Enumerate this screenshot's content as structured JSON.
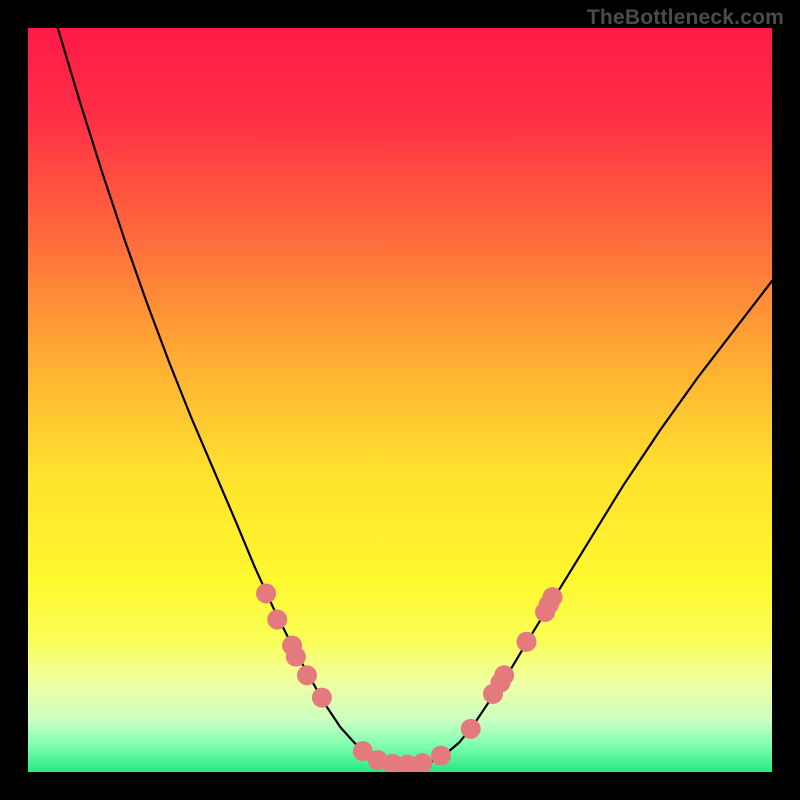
{
  "watermark": "TheBottleneck.com",
  "gradient_stops": [
    {
      "offset": 0.0,
      "color": "#ff1a47"
    },
    {
      "offset": 0.12,
      "color": "#ff2f45"
    },
    {
      "offset": 0.28,
      "color": "#ff6a3c"
    },
    {
      "offset": 0.44,
      "color": "#ffab33"
    },
    {
      "offset": 0.6,
      "color": "#ffe22e"
    },
    {
      "offset": 0.74,
      "color": "#fff82f"
    },
    {
      "offset": 0.82,
      "color": "#fbff55"
    },
    {
      "offset": 0.88,
      "color": "#efffa2"
    },
    {
      "offset": 0.93,
      "color": "#ccffc2"
    },
    {
      "offset": 0.965,
      "color": "#7dffaf"
    },
    {
      "offset": 1.0,
      "color": "#26e980"
    }
  ],
  "marker_color": "#e47a7d",
  "marker_radius": 10,
  "curve_color": "#000000",
  "curve_width": 2.2,
  "chart_data": {
    "type": "line",
    "title": "",
    "xlabel": "",
    "ylabel": "",
    "xlim": [
      0,
      100
    ],
    "ylim": [
      0,
      100
    ],
    "note": "Axes are unitless; shape is a V-curve with a flat minimum. y≈0 is optimal (green), y≈100 is worst (red). Values are estimated from pixel geometry.",
    "curve": {
      "x": [
        4,
        7,
        10,
        13,
        16,
        19,
        22,
        25,
        28,
        30.5,
        33,
        35.5,
        38,
        40,
        42,
        44,
        46,
        48,
        50,
        52,
        54,
        56,
        58,
        60,
        62,
        65,
        68,
        72,
        76,
        80,
        85,
        90,
        95,
        100
      ],
      "y": [
        100,
        90,
        80.5,
        71.5,
        63,
        55,
        47.5,
        40.5,
        33.5,
        27.5,
        22,
        17,
        12.5,
        9,
        6,
        3.8,
        2.3,
        1.3,
        1,
        1,
        1.3,
        2.3,
        4,
        6.5,
        9.5,
        14,
        19,
        25.5,
        32,
        38.5,
        46,
        53,
        59.5,
        66
      ]
    },
    "markers": [
      {
        "x": 32.0,
        "y": 24.0
      },
      {
        "x": 33.5,
        "y": 20.5
      },
      {
        "x": 35.5,
        "y": 17.0
      },
      {
        "x": 36.0,
        "y": 15.5
      },
      {
        "x": 37.5,
        "y": 13.0
      },
      {
        "x": 39.5,
        "y": 10.0
      },
      {
        "x": 45.0,
        "y": 2.8
      },
      {
        "x": 47.0,
        "y": 1.6
      },
      {
        "x": 49.0,
        "y": 1.1
      },
      {
        "x": 51.0,
        "y": 1.0
      },
      {
        "x": 53.0,
        "y": 1.2
      },
      {
        "x": 55.5,
        "y": 2.2
      },
      {
        "x": 59.5,
        "y": 5.8
      },
      {
        "x": 62.5,
        "y": 10.5
      },
      {
        "x": 63.5,
        "y": 12.0
      },
      {
        "x": 64.0,
        "y": 13.0
      },
      {
        "x": 67.0,
        "y": 17.5
      },
      {
        "x": 69.5,
        "y": 21.5
      },
      {
        "x": 70.0,
        "y": 22.5
      },
      {
        "x": 70.5,
        "y": 23.5
      }
    ]
  }
}
